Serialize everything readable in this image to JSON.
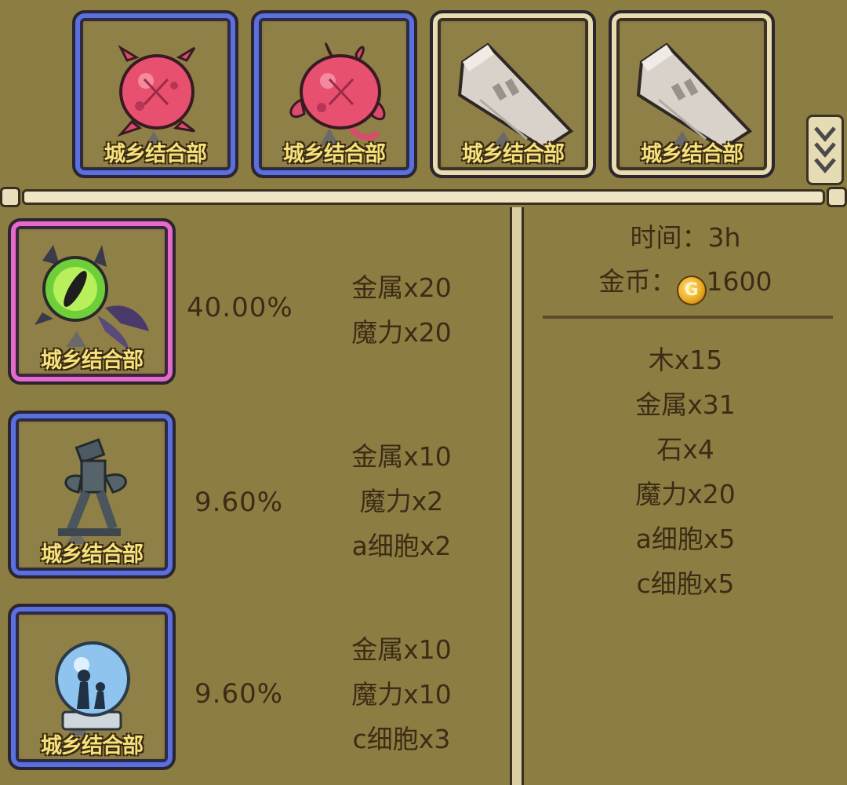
{
  "top_items": [
    {
      "rarity": "blue",
      "icon": "pink-spiked-ball-icon",
      "tag": "城乡结合部"
    },
    {
      "rarity": "blue",
      "icon": "pink-cracked-creature-icon",
      "tag": "城乡结合部"
    },
    {
      "rarity": "tan",
      "icon": "stone-slab-icon",
      "tag": "城乡结合部"
    },
    {
      "rarity": "tan",
      "icon": "stone-slab-icon",
      "tag": "城乡结合部"
    }
  ],
  "rewards": [
    {
      "rarity": "pink",
      "icon": "green-eye-orb-icon",
      "tag": "城乡结合部",
      "chance": "40.00%",
      "materials": [
        "金属x20",
        "魔力x20"
      ]
    },
    {
      "rarity": "blue",
      "icon": "winged-statue-icon",
      "tag": "城乡结合部",
      "chance": "9.60%",
      "materials": [
        "金属x10",
        "魔力x2",
        "a细胞x2"
      ]
    },
    {
      "rarity": "blue",
      "icon": "snow-globe-icon",
      "tag": "城乡结合部",
      "chance": "9.60%",
      "materials": [
        "金属x10",
        "魔力x10",
        "c细胞x3"
      ]
    }
  ],
  "info": {
    "time": "时间：3h",
    "gold_label": "金币：",
    "gold_value": "1600",
    "coin_symbol": "G"
  },
  "requirements": [
    "木x15",
    "金属x31",
    "石x4",
    "魔力x20",
    "a细胞x5",
    "c细胞x5"
  ],
  "colors": {
    "blue_frame": "#5a6fe0",
    "tan_frame": "#e8dcb0",
    "pink_frame": "#e66ac9",
    "background": "#8c7e42"
  }
}
